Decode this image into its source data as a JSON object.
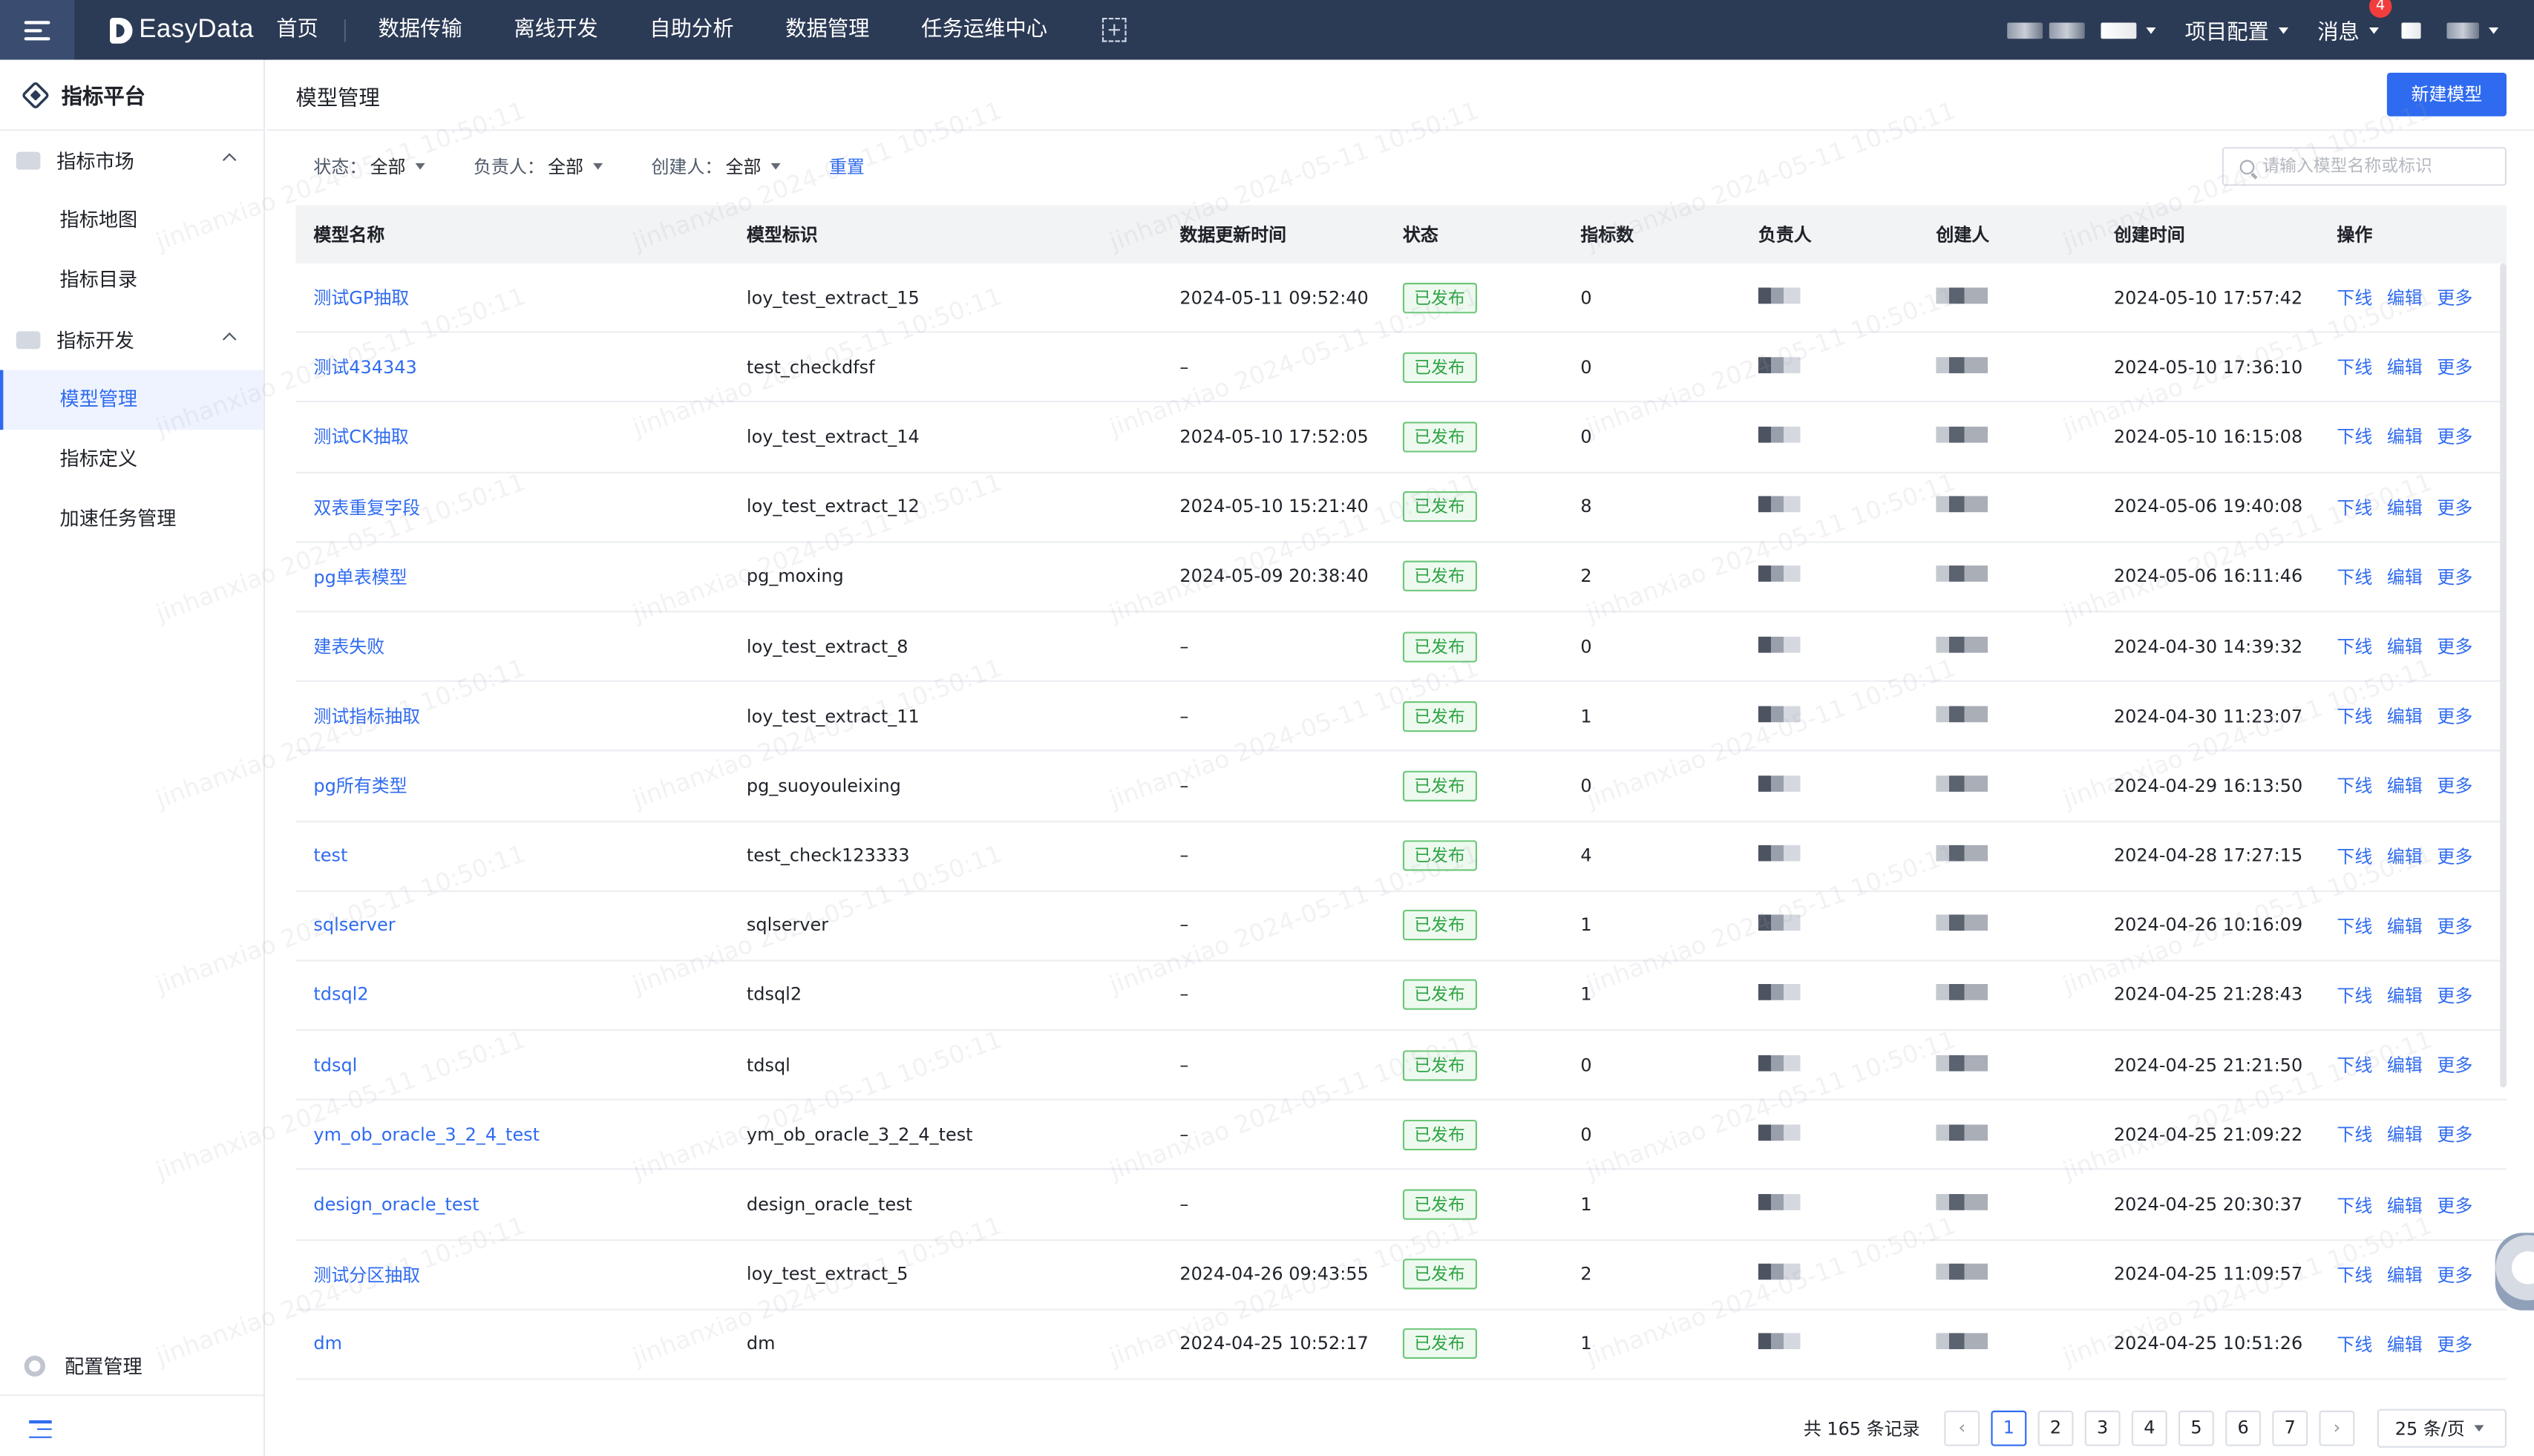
{
  "topbar": {
    "logo": "EasyData",
    "nav": [
      "首页",
      "数据传输",
      "离线开发",
      "自助分析",
      "数据管理",
      "任务运维中心"
    ],
    "project_config": "项目配置",
    "messages": "消息",
    "message_badge": "4"
  },
  "sidebar": {
    "title": "指标平台",
    "groups": [
      {
        "label": "指标市场",
        "items": [
          "指标地图",
          "指标目录"
        ]
      },
      {
        "label": "指标开发",
        "items": [
          "模型管理",
          "指标定义",
          "加速任务管理"
        ]
      }
    ],
    "active_item": "模型管理",
    "bottom": "配置管理"
  },
  "page": {
    "title": "模型管理",
    "new_button": "新建模型",
    "filters": [
      {
        "label": "状态：",
        "value": "全部"
      },
      {
        "label": "负责人：",
        "value": "全部"
      },
      {
        "label": "创建人：",
        "value": "全部"
      }
    ],
    "reset": "重置",
    "search_placeholder": "请输入模型名称或标识"
  },
  "table": {
    "columns": [
      "模型名称",
      "模型标识",
      "数据更新时间",
      "状态",
      "指标数",
      "负责人",
      "创建人",
      "创建时间",
      "操作"
    ],
    "actions": [
      "下线",
      "编辑",
      "更多"
    ],
    "rows": [
      {
        "name": "测试GP抽取",
        "id": "loy_test_extract_15",
        "updated": "2024-05-11 09:52:40",
        "status": "已发布",
        "count": "0",
        "created": "2024-05-10 17:57:42"
      },
      {
        "name": "测试434343",
        "id": "test_checkdfsf",
        "updated": "–",
        "status": "已发布",
        "count": "0",
        "created": "2024-05-10 17:36:10"
      },
      {
        "name": "测试CK抽取",
        "id": "loy_test_extract_14",
        "updated": "2024-05-10 17:52:05",
        "status": "已发布",
        "count": "0",
        "created": "2024-05-10 16:15:08"
      },
      {
        "name": "双表重复字段",
        "id": "loy_test_extract_12",
        "updated": "2024-05-10 15:21:40",
        "status": "已发布",
        "count": "8",
        "created": "2024-05-06 19:40:08"
      },
      {
        "name": "pg单表模型",
        "id": "pg_moxing",
        "updated": "2024-05-09 20:38:40",
        "status": "已发布",
        "count": "2",
        "created": "2024-05-06 16:11:46"
      },
      {
        "name": "建表失败",
        "id": "loy_test_extract_8",
        "updated": "–",
        "status": "已发布",
        "count": "0",
        "created": "2024-04-30 14:39:32"
      },
      {
        "name": "测试指标抽取",
        "id": "loy_test_extract_11",
        "updated": "–",
        "status": "已发布",
        "count": "1",
        "created": "2024-04-30 11:23:07"
      },
      {
        "name": "pg所有类型",
        "id": "pg_suoyouleixing",
        "updated": "–",
        "status": "已发布",
        "count": "0",
        "created": "2024-04-29 16:13:50"
      },
      {
        "name": "test",
        "id": "test_check123333",
        "updated": "–",
        "status": "已发布",
        "count": "4",
        "created": "2024-04-28 17:27:15"
      },
      {
        "name": "sqlserver",
        "id": "sqlserver",
        "updated": "–",
        "status": "已发布",
        "count": "1",
        "created": "2024-04-26 10:16:09"
      },
      {
        "name": "tdsql2",
        "id": "tdsql2",
        "updated": "–",
        "status": "已发布",
        "count": "1",
        "created": "2024-04-25 21:28:43"
      },
      {
        "name": "tdsql",
        "id": "tdsql",
        "updated": "–",
        "status": "已发布",
        "count": "0",
        "created": "2024-04-25 21:21:50"
      },
      {
        "name": "ym_ob_oracle_3_2_4_test",
        "id": "ym_ob_oracle_3_2_4_test",
        "updated": "–",
        "status": "已发布",
        "count": "0",
        "created": "2024-04-25 21:09:22"
      },
      {
        "name": "design_oracle_test",
        "id": "design_oracle_test",
        "updated": "–",
        "status": "已发布",
        "count": "1",
        "created": "2024-04-25 20:30:37"
      },
      {
        "name": "测试分区抽取",
        "id": "loy_test_extract_5",
        "updated": "2024-04-26 09:43:55",
        "status": "已发布",
        "count": "2",
        "created": "2024-04-25 11:09:57"
      },
      {
        "name": "dm",
        "id": "dm",
        "updated": "2024-04-25 10:52:17",
        "status": "已发布",
        "count": "1",
        "created": "2024-04-25 10:51:26"
      }
    ]
  },
  "pagination": {
    "total": "共 165 条记录",
    "pages": [
      "1",
      "2",
      "3",
      "4",
      "5",
      "6",
      "7"
    ],
    "current": "1",
    "per_page": "25 条/页"
  },
  "colors": {
    "primary": "#2f6bf0",
    "topbar": "#2b3a55",
    "success": "#2ea343"
  }
}
